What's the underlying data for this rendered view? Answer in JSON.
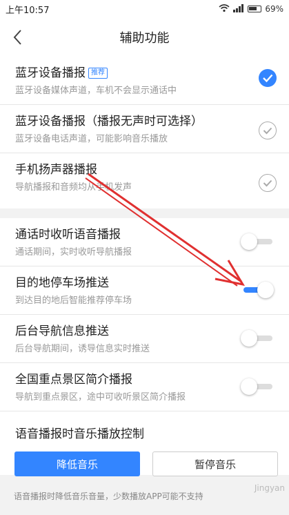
{
  "status_bar": {
    "time": "上午10:57",
    "battery": "69%"
  },
  "header": {
    "title": "辅助功能"
  },
  "broadcast_group": [
    {
      "title": "蓝牙设备播报",
      "tag": "推荐",
      "sub": "蓝牙设备媒体声道，车机不会显示通话中",
      "checked": true
    },
    {
      "title": "蓝牙设备播报（播报无声时可选择）",
      "sub": "蓝牙设备电话声道，可能影响音乐播放",
      "checked": false
    },
    {
      "title": "手机扬声器播报",
      "sub": "导航播报和音频均从手机发声",
      "checked": false
    }
  ],
  "toggles": [
    {
      "title": "通话时收听语音播报",
      "sub": "通话期间，实时收听导航播报",
      "on": false
    },
    {
      "title": "目的地停车场推送",
      "sub": "到达目的地后智能推荐停车场",
      "on": true
    },
    {
      "title": "后台导航信息推送",
      "sub": "后台导航期间，诱导信息实时推送",
      "on": false
    },
    {
      "title": "全国重点景区简介播报",
      "sub": "导航到重点景区，途中可收听景区简介播报",
      "on": false
    }
  ],
  "music_control": {
    "title": "语音播报时音乐播放控制",
    "lower_label": "降低音乐",
    "pause_label": "暂停音乐",
    "note": "语音播报时降低音乐音量，少数播放APP可能不支持"
  },
  "watermark": "Jingyan",
  "colors": {
    "accent": "#3385ff",
    "annotation": "#e03030"
  }
}
